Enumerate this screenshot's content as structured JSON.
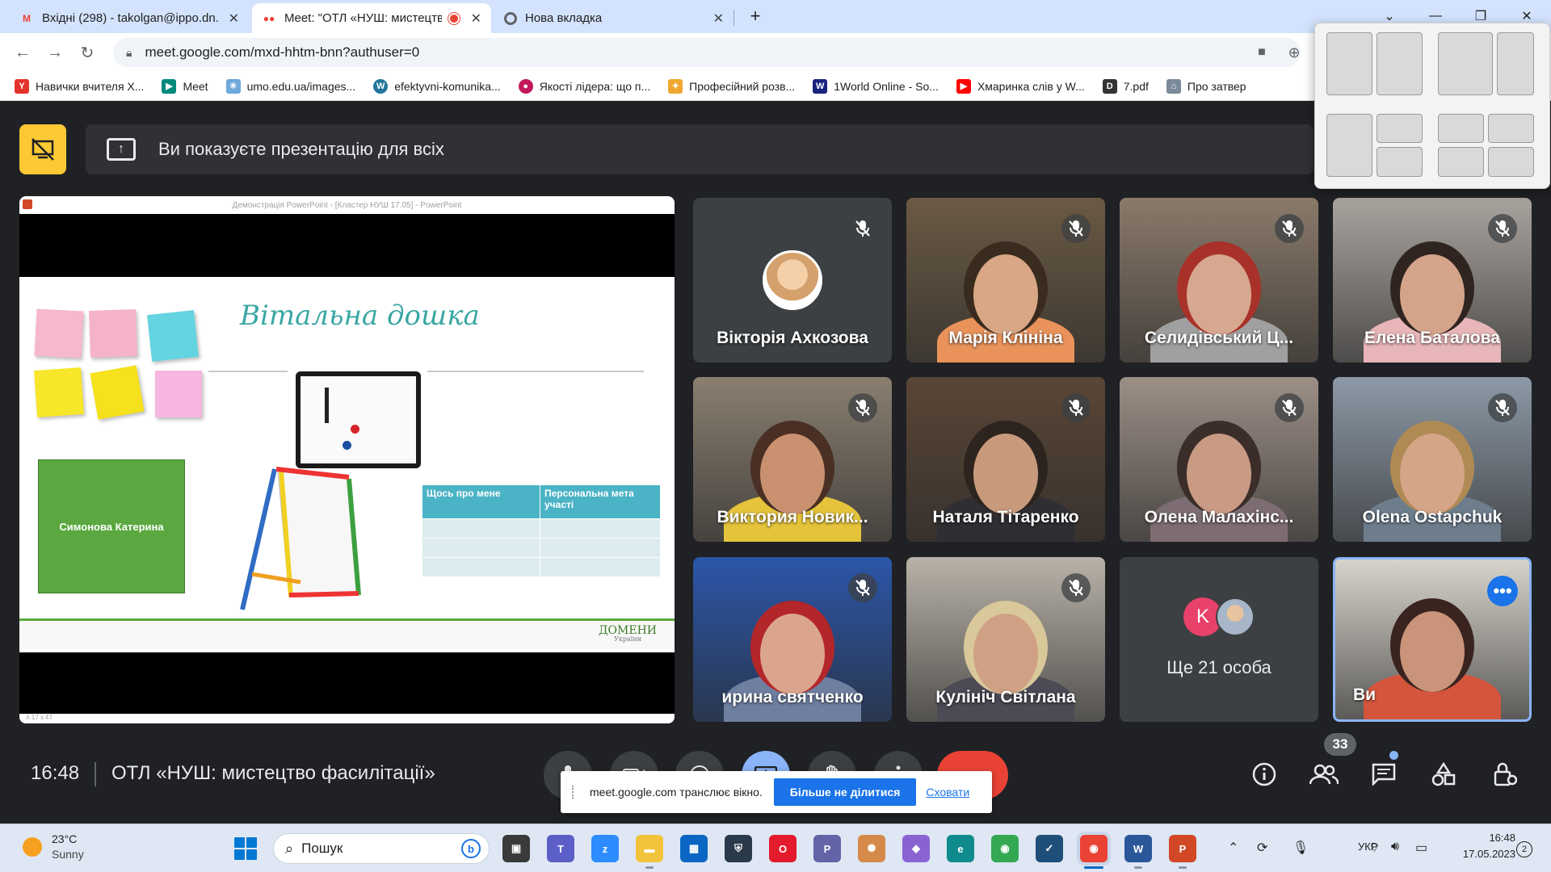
{
  "browser": {
    "tabs": [
      {
        "title": "Вхідні (298) - takolgan@ippo.dn.",
        "favicon": "gmail-icon",
        "active": false
      },
      {
        "title": "Meet: \"ОТЛ «НУШ: мистецтв",
        "favicon": "meet-icon",
        "active": true
      },
      {
        "title": "Нова вкладка",
        "favicon": "chrome-icon",
        "active": false
      }
    ],
    "new_tab": "+",
    "url": "meet.google.com/mxd-hhtm-bnn?authuser=0",
    "bookmarks": [
      {
        "label": "Навички вчителя Х...",
        "icon": "y-icon",
        "color": "#e4332b"
      },
      {
        "label": "Meet",
        "icon": "meet-icon",
        "color": "#00897b"
      },
      {
        "label": "umo.edu.ua/images...",
        "icon": "umo-icon",
        "color": "#6fa8dc"
      },
      {
        "label": "efektyvni-komunika...",
        "icon": "wordpress-icon",
        "color": "#21759b"
      },
      {
        "label": "Якості лідера: що п...",
        "icon": "leader-icon",
        "color": "#c2185b"
      },
      {
        "label": "Професійний розв...",
        "icon": "dev-icon",
        "color": "#f0a830"
      },
      {
        "label": "1World Online - So...",
        "icon": "world-icon",
        "color": "#1a237e"
      },
      {
        "label": "Хмаринка слів у W...",
        "icon": "youtube-icon",
        "color": "#ff0000"
      },
      {
        "label": "7.pdf",
        "icon": "pdf-icon",
        "color": "#333333"
      },
      {
        "label": "Про затвер",
        "icon": "gov-icon",
        "color": "#7b8a9a"
      }
    ]
  },
  "meet": {
    "banner_text": "Ви показуєте презентацію для всіх",
    "presentation": {
      "window_title": "Демонстрація PowerPoint - [Кластер НУШ 17.05] - PowerPoint",
      "slide_title": "Вітальна дошка",
      "card_name": "Симонова Катерина",
      "table_headers": [
        "Щось про мене",
        "Персональна мета участі"
      ],
      "footer_logo": "ДОМЕНИ",
      "footer_logo_sub": "України",
      "status": "л 17 з 47"
    },
    "participants": [
      {
        "name": "Вікторія Ахкозова",
        "muted": true,
        "kind": "avatar"
      },
      {
        "name": "Марія Клініна",
        "muted": true,
        "kind": "video",
        "bg": "#6b5a44",
        "skin": "#d9a785",
        "hair": "#3a2b1f",
        "shirt": "#e9935b"
      },
      {
        "name": "Селидівський Ц...",
        "muted": true,
        "kind": "video",
        "bg": "#8a7a6a",
        "skin": "#d7a890",
        "hair": "#a8322a",
        "shirt": "#a0a0a0"
      },
      {
        "name": "Елена Баталова",
        "muted": true,
        "kind": "video",
        "bg": "#a9a39e",
        "skin": "#d4a48a",
        "hair": "#2f2420",
        "shirt": "#e8b6b8"
      },
      {
        "name": "Виктория Новик...",
        "muted": true,
        "kind": "video",
        "bg": "#8a7f70",
        "skin": "#c9916f",
        "hair": "#4a2f24",
        "shirt": "#e5c43b"
      },
      {
        "name": "Наталя Тітаренко",
        "muted": true,
        "kind": "video",
        "bg": "#5a4636",
        "skin": "#c89a7c",
        "hair": "#2d241f",
        "shirt": "#2f2f33"
      },
      {
        "name": "Олена Малахінс...",
        "muted": true,
        "kind": "video",
        "bg": "#9c8f86",
        "skin": "#c99a84",
        "hair": "#3b2e29",
        "shirt": "#7d6d72"
      },
      {
        "name": "Olena Ostapchuk",
        "muted": true,
        "kind": "video",
        "bg": "#8c99a6",
        "skin": "#d4a586",
        "hair": "#b08a55",
        "shirt": "#6d7d8c"
      },
      {
        "name": "ирина святченко",
        "muted": true,
        "kind": "video",
        "bg": "#2b56a8",
        "skin": "#dba58d",
        "hair": "#b3262a",
        "shirt": "#6e7fa0"
      },
      {
        "name": "Кулініч Світлана",
        "muted": true,
        "kind": "video",
        "bg": "#b8b2a8",
        "skin": "#d0a085",
        "hair": "#d8c89a",
        "shirt": "#4b4a55"
      },
      {
        "name": "Ще 21 особа",
        "muted": false,
        "kind": "more",
        "avatar_letter": "K"
      },
      {
        "name": "Ви",
        "muted": false,
        "kind": "self",
        "bg": "#d8d4cc",
        "skin": "#c9947a",
        "hair": "#3a2420",
        "shirt": "#d4553c"
      }
    ],
    "time": "16:48",
    "meeting_title": "ОТЛ «НУШ: мистецтво фасилітації»",
    "participant_count": "33",
    "share_notification": {
      "text": "meet.google.com транслює вікно.",
      "stop_button": "Більше не ділитися",
      "hide_link": "Сховати"
    }
  },
  "taskbar": {
    "weather_temp": "23°C",
    "weather_desc": "Sunny",
    "search_placeholder": "Пошук",
    "language": "УКР",
    "time": "16:48",
    "date": "17.05.2023",
    "notifications": "2"
  }
}
